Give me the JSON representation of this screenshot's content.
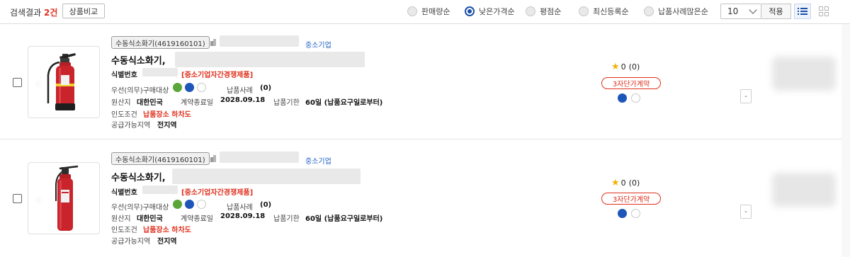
{
  "header": {
    "result_label": "검색결과",
    "result_count": "2건",
    "compare_button": "상품비교",
    "sort_options": [
      {
        "label": "판매량순",
        "selected": false
      },
      {
        "label": "낮은가격순",
        "selected": true
      },
      {
        "label": "평점순",
        "selected": false
      },
      {
        "label": "최신등록순",
        "selected": false
      },
      {
        "label": "납품사례많은순",
        "selected": false
      }
    ],
    "page_size": "10",
    "apply_button": "적용",
    "view_list_icon": "list-view-icon",
    "view_grid_icon": "grid-view-icon"
  },
  "products": [
    {
      "category_tag": "수동식소화기(4619160101)",
      "business_type": "중소기업",
      "name": "수동식소화기,",
      "id_label": "식별번호",
      "competition_tag": "[중소기업자간경쟁제품]",
      "priority_label": "우선(의무)구매대상",
      "delivery_cases_label": "납품사례",
      "delivery_cases_value": "(0)",
      "origin_label": "원산지",
      "origin_value": "대한민국",
      "contract_end_label": "계약종료일",
      "contract_end_value": "2028.09.18",
      "delivery_period_label": "납품기한",
      "delivery_period_value": "60일 (납품요구일로부터)",
      "delivery_terms_label": "인도조건",
      "delivery_terms_value": "납품장소 하차도",
      "supply_area_label": "공급가능지역",
      "supply_area_value": "전지역",
      "rating": "0",
      "rating_count": "(0)",
      "contract_type": "3자단가계약",
      "side_button": "-"
    },
    {
      "category_tag": "수동식소화기(4619160101)",
      "business_type": "중소기업",
      "name": "수동식소화기,",
      "id_label": "식별번호",
      "competition_tag": "[중소기업자간경쟁제품]",
      "priority_label": "우선(의무)구매대상",
      "delivery_cases_label": "납품사례",
      "delivery_cases_value": "(0)",
      "origin_label": "원산지",
      "origin_value": "대한민국",
      "contract_end_label": "계약종료일",
      "contract_end_value": "2028.09.18",
      "delivery_period_label": "납품기한",
      "delivery_period_value": "60일 (납품요구일로부터)",
      "delivery_terms_label": "인도조건",
      "delivery_terms_value": "납품장소 하차도",
      "supply_area_label": "공급가능지역",
      "supply_area_value": "전지역",
      "rating": "0",
      "rating_count": "(0)",
      "contract_type": "3자단가계약",
      "side_button": "-"
    }
  ],
  "colors": {
    "accent_blue": "#1c4fa8",
    "red_tag": "#e0301e",
    "extinguisher_red": "#c9242b"
  }
}
